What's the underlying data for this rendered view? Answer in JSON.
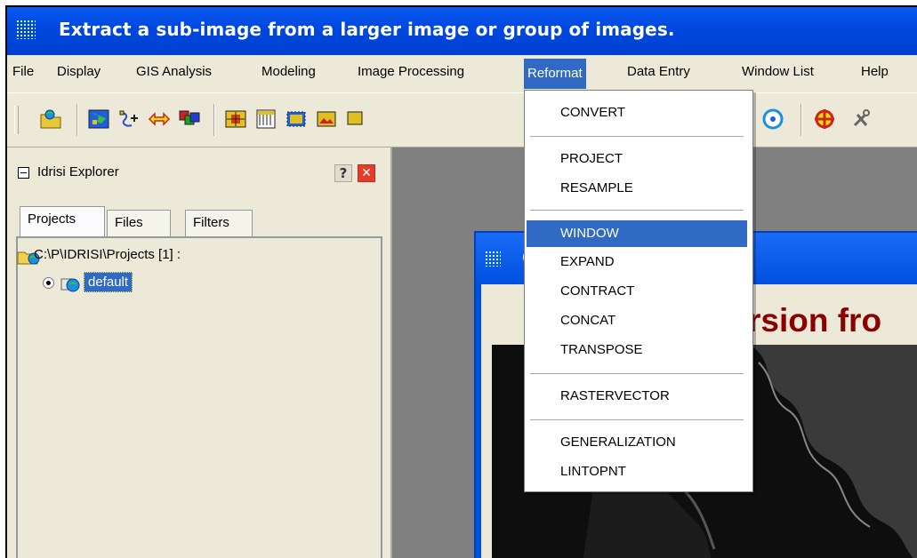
{
  "window": {
    "title": "Extract a sub-image from a larger image or group of images."
  },
  "menubar": {
    "items": [
      "File",
      "Display",
      "GIS Analysis",
      "Modeling",
      "Image Processing",
      "Reformat",
      "Data Entry",
      "Window List",
      "Help"
    ],
    "active": "Reformat"
  },
  "toolbar": {
    "icons": [
      "open-folder-icon",
      "map-display-icon",
      "digitize-icon",
      "swap-arrows-icon",
      "layers-icon",
      "composite-icon",
      "sheet-icon",
      "window-icon",
      "image-icon",
      "target-icon",
      "crosshair-icon",
      "tools-icon"
    ]
  },
  "explorer": {
    "title": "Idrisi Explorer",
    "help_label": "?",
    "close_label": "✕",
    "tabs": [
      "Projects",
      "Files",
      "Filters"
    ],
    "active_tab": "Projects",
    "tree": {
      "path": "C:\\P\\IDRISI\\Projects [1] :",
      "project": "default"
    }
  },
  "document_window": {
    "title_fragment": "C",
    "heading_fragment": "rsion fro"
  },
  "reformat_menu": {
    "groups": [
      [
        "CONVERT"
      ],
      [
        "PROJECT",
        "RESAMPLE"
      ],
      [
        "WINDOW",
        "EXPAND",
        "CONTRACT",
        "CONCAT",
        "TRANSPOSE"
      ],
      [
        "RASTERVECTOR"
      ],
      [
        "GENERALIZATION",
        "LINTOPNT"
      ]
    ],
    "highlighted": "WINDOW"
  },
  "colors": {
    "title_bar": "#0048e0",
    "menu_highlight": "#316ac5",
    "heading_text": "#8b0000",
    "face": "#ece9d8"
  }
}
